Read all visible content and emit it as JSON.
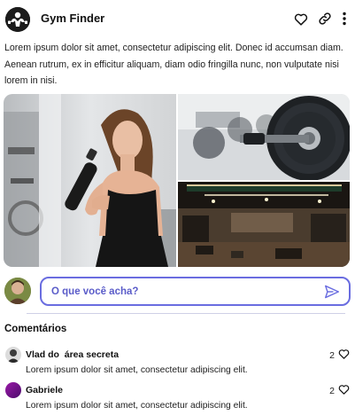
{
  "header": {
    "title": "Gym Finder",
    "logo_icon": "gym-logo-icon",
    "actions": [
      "heart-icon",
      "link-icon",
      "more-vertical-icon"
    ]
  },
  "post": {
    "description": "Lorem ipsum dolor sit amet, consectetur adipiscing elit. Donec id accumsan diam. Aenean rutrum, ex in efficitur aliquam, diam odio fringilla nunc, non vulputate nisi lorem in nisi.",
    "photos": [
      "woman-drinking-water-photo",
      "weight-plates-photo",
      "gym-interior-photo"
    ]
  },
  "comment_input": {
    "placeholder": "O que você acha?",
    "send_icon": "send-icon"
  },
  "comments": {
    "title": "Comentários",
    "items": [
      {
        "author": "Vlad do  área secreta",
        "text": "Lorem ipsum dolor sit amet, consectetur adipiscing elit.",
        "likes": "2"
      },
      {
        "author": "Gabriele",
        "text": "Lorem ipsum dolor sit amet, consectetur adipiscing elit.",
        "likes": "2"
      }
    ]
  },
  "colors": {
    "accent": "#6a6de0",
    "text": "#1d1d1d"
  }
}
